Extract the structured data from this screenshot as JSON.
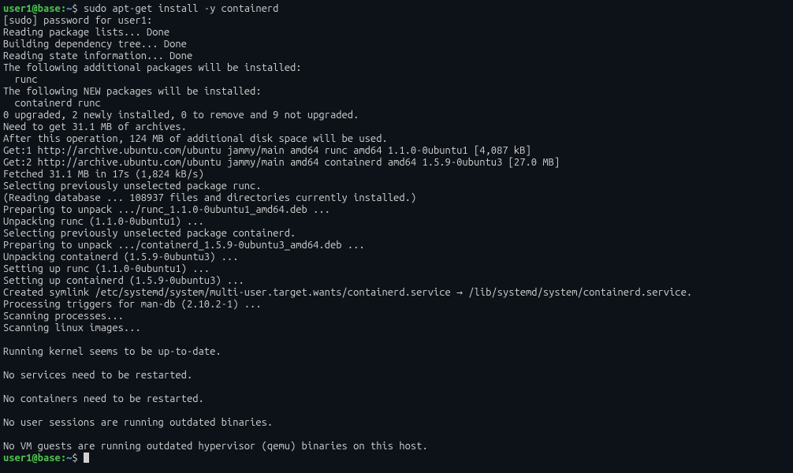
{
  "prompt": {
    "user_host": "user1@base",
    "separator": ":",
    "path": "~",
    "symbol": "$ "
  },
  "command": "sudo apt-get install -y containerd",
  "output_lines": [
    "[sudo] password for user1:",
    "Reading package lists... Done",
    "Building dependency tree... Done",
    "Reading state information... Done",
    "The following additional packages will be installed:",
    "  runc",
    "The following NEW packages will be installed:",
    "  containerd runc",
    "0 upgraded, 2 newly installed, 0 to remove and 9 not upgraded.",
    "Need to get 31.1 MB of archives.",
    "After this operation, 124 MB of additional disk space will be used.",
    "Get:1 http://archive.ubuntu.com/ubuntu jammy/main amd64 runc amd64 1.1.0-0ubuntu1 [4,087 kB]",
    "Get:2 http://archive.ubuntu.com/ubuntu jammy/main amd64 containerd amd64 1.5.9-0ubuntu3 [27.0 MB]",
    "Fetched 31.1 MB in 17s (1,824 kB/s)",
    "Selecting previously unselected package runc.",
    "(Reading database ... 108937 files and directories currently installed.)",
    "Preparing to unpack .../runc_1.1.0-0ubuntu1_amd64.deb ...",
    "Unpacking runc (1.1.0-0ubuntu1) ...",
    "Selecting previously unselected package containerd.",
    "Preparing to unpack .../containerd_1.5.9-0ubuntu3_amd64.deb ...",
    "Unpacking containerd (1.5.9-0ubuntu3) ...",
    "Setting up runc (1.1.0-0ubuntu1) ...",
    "Setting up containerd (1.5.9-0ubuntu3) ...",
    "Created symlink /etc/systemd/system/multi-user.target.wants/containerd.service → /lib/systemd/system/containerd.service.",
    "Processing triggers for man-db (2.10.2-1) ...",
    "Scanning processes...",
    "Scanning linux images...",
    "",
    "Running kernel seems to be up-to-date.",
    "",
    "No services need to be restarted.",
    "",
    "No containers need to be restarted.",
    "",
    "No user sessions are running outdated binaries.",
    "",
    "No VM guests are running outdated hypervisor (qemu) binaries on this host."
  ]
}
